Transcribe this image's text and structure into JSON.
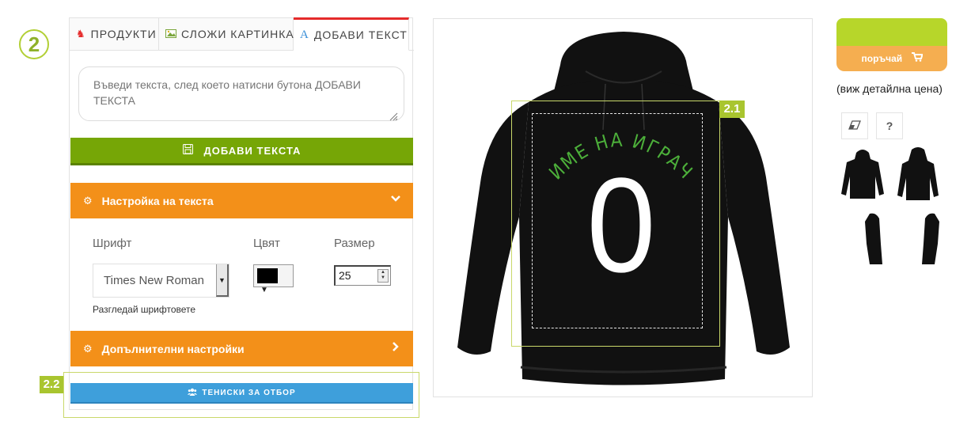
{
  "step_number": "2",
  "tabs": [
    {
      "label": "ПРОДУКТИ",
      "icon": "shirt-icon"
    },
    {
      "label": "СЛОЖИ КАРТИНКА",
      "icon": "picture-icon"
    },
    {
      "label": "ДОБАВИ ТЕКСТ",
      "icon": "text-a-icon",
      "active": true
    }
  ],
  "text_input": {
    "placeholder": "Въведи текста, след което натисни бутона ДОБАВИ ТЕКСТА",
    "value": ""
  },
  "add_text_button": "ДОБАВИ ТЕКСТА",
  "text_settings": {
    "title": "Настройка на текста",
    "font_label": "Шрифт",
    "font_value": "Times New Roman",
    "browse_fonts": "Разгледай шрифтовете",
    "color_label": "Цвят",
    "color_value": "#000000",
    "size_label": "Размер",
    "size_value": "25"
  },
  "extra_settings": {
    "title": "Допълнителни настройки"
  },
  "team_shirts_button": "ТЕНИСКИ ЗА ОТБОР",
  "markers": {
    "panel": "2.2",
    "preview": "2.1"
  },
  "design": {
    "curved_text": "ИМЕ НА ИГРАЧ",
    "curved_text_color": "#4caf3a",
    "number": "0",
    "number_color": "#ffffff"
  },
  "product": {
    "name": "hoodie",
    "color": "#111111"
  },
  "order": {
    "button": "поръчай",
    "price_link": "(виж детайлна цена)"
  },
  "thumbnails": [
    "hoodie-front",
    "hoodie-back",
    "hoodie-left-sleeve",
    "hoodie-right-sleeve"
  ],
  "colors": {
    "green": "#76a606",
    "orange": "#f39019",
    "blue": "#3e9fdb",
    "accent_red": "#e52b2b",
    "lime": "#b7d62a"
  }
}
